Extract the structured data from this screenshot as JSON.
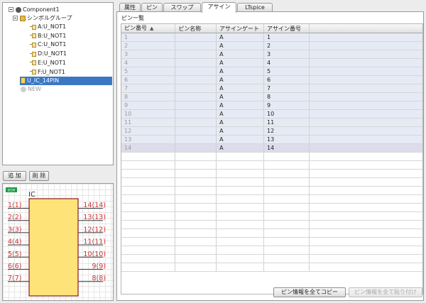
{
  "tree": {
    "root": "Component1",
    "group": "シンボルグループ",
    "gates": [
      "A:U_NOT1",
      "B:U_NOT1",
      "C:U_NOT1",
      "D:U_NOT1",
      "E:U_NOT1",
      "F:U_NOT1"
    ],
    "selected": "U_IC_14PIN",
    "new_item": "NEW"
  },
  "buttons": {
    "add": "追 加",
    "delete": "削 除"
  },
  "preview": {
    "badge": "IECM",
    "ic_label": "IC",
    "left_pins": [
      "1(1)",
      "2(2)",
      "3(3)",
      "4(4)",
      "5(5)",
      "6(6)",
      "7(7)"
    ],
    "right_pins": [
      "14(14)",
      "13(13)",
      "12(12)",
      "11(11)",
      "10(10)",
      "9(9)",
      "8(8)"
    ]
  },
  "tabs": [
    "属性",
    "ピン",
    "スワップ",
    "アサイン",
    "LTspice"
  ],
  "active_tab": "アサイン",
  "panel": {
    "title": "ピン一覧",
    "columns": [
      "ピン番号",
      "ピン名称",
      "アサインゲート",
      "アサイン番号"
    ],
    "sort_indicator": "▲",
    "rows": [
      [
        "1",
        "",
        "A",
        "1"
      ],
      [
        "2",
        "",
        "A",
        "2"
      ],
      [
        "3",
        "",
        "A",
        "3"
      ],
      [
        "4",
        "",
        "A",
        "4"
      ],
      [
        "5",
        "",
        "A",
        "5"
      ],
      [
        "6",
        "",
        "A",
        "6"
      ],
      [
        "7",
        "",
        "A",
        "7"
      ],
      [
        "8",
        "",
        "A",
        "8"
      ],
      [
        "9",
        "",
        "A",
        "9"
      ],
      [
        "10",
        "",
        "A",
        "10"
      ],
      [
        "11",
        "",
        "A",
        "11"
      ],
      [
        "12",
        "",
        "A",
        "12"
      ],
      [
        "13",
        "",
        "A",
        "13"
      ],
      [
        "14",
        "",
        "A",
        "14"
      ]
    ],
    "copy_all": "ピン情報を全てコピー",
    "paste_all": "ピン情報を全て貼り付け"
  },
  "colors": {
    "selection": "#3a78c4",
    "ic_body": "#fee379",
    "ic_outline": "#8b1a1a",
    "pin_text": "#cc3333"
  }
}
